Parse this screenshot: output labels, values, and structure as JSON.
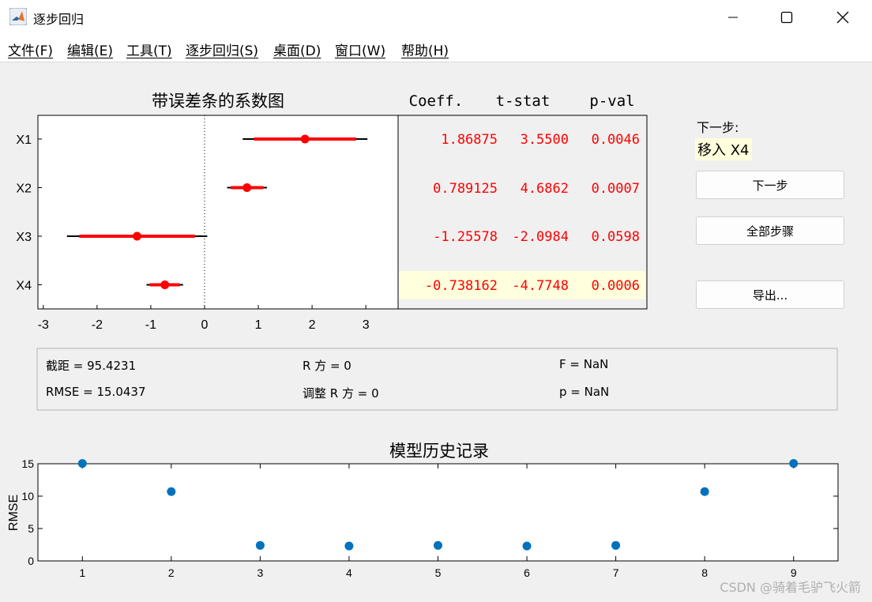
{
  "window": {
    "title": "逐步回归",
    "minimize_label": "—",
    "maximize_label": "☐",
    "close_label": "✕"
  },
  "menu": [
    "文件(F)",
    "编辑(E)",
    "工具(T)",
    "逐步回归(S)",
    "桌面(D)",
    "窗口(W)",
    "帮助(H)"
  ],
  "coef_plot": {
    "title": "带误差条的系数图",
    "terms": [
      "X1",
      "X2",
      "X3",
      "X4"
    ],
    "xticks": [
      "-3",
      "-2",
      "-1",
      "0",
      "1",
      "2",
      "3"
    ]
  },
  "coef_table": {
    "headers": [
      "Coeff.",
      "t-stat",
      "p-val"
    ],
    "rows": [
      {
        "coeff": "1.86875",
        "tstat": "3.5500",
        "pval": "0.0046",
        "highlight": false
      },
      {
        "coeff": "0.789125",
        "tstat": "4.6862",
        "pval": "0.0007",
        "highlight": false
      },
      {
        "coeff": "-1.25578",
        "tstat": "-2.0984",
        "pval": "0.0598",
        "highlight": false
      },
      {
        "coeff": "-0.738162",
        "tstat": "-4.7748",
        "pval": "0.0006",
        "highlight": true
      }
    ],
    "value_color": "#ff0000",
    "highlight_color": "#ffffdd"
  },
  "side_panel": {
    "next_step_label": "下一步:",
    "next_step_value": "移入 X4",
    "next_button": "下一步",
    "all_steps_button": "全部步骤",
    "export_button": "导出..."
  },
  "stats": {
    "intercept": "截距 = 95.4231",
    "r2": "R 方 = 0",
    "f": "F = NaN",
    "rmse": "RMSE = 15.0437",
    "adj_r2": "调整 R 方 = 0",
    "p": "p = NaN"
  },
  "chart_data": [
    {
      "type": "scatter",
      "title": "带误差条的系数图",
      "categories": [
        "X1",
        "X2",
        "X3",
        "X4"
      ],
      "coefficients": [
        1.86875,
        0.789125,
        -1.25578,
        -0.738162
      ],
      "ci_inner": [
        [
          0.92,
          2.82
        ],
        [
          0.49,
          1.09
        ],
        [
          -2.33,
          -0.18
        ],
        [
          -1.02,
          -0.46
        ]
      ],
      "ci_outer": [
        [
          0.71,
          3.03
        ],
        [
          0.42,
          1.16
        ],
        [
          -2.56,
          0.05
        ],
        [
          -1.08,
          -0.4
        ]
      ],
      "xlim": [
        -3.1,
        3.6
      ],
      "color": "#ff0000",
      "zero_line": true
    },
    {
      "type": "scatter",
      "title": "模型历史记录",
      "xlabel": "",
      "ylabel": "RMSE",
      "x": [
        1,
        2,
        3,
        4,
        5,
        6,
        7,
        8,
        9
      ],
      "y": [
        15.04,
        10.7,
        2.4,
        2.3,
        2.4,
        2.3,
        2.4,
        10.7,
        15.04
      ],
      "xlim": [
        0.5,
        9.5
      ],
      "ylim": [
        0,
        15
      ],
      "yticks": [
        0,
        5,
        10,
        15
      ],
      "color": "#0072bd"
    }
  ],
  "watermark": "CSDN @骑着毛驴飞火箭"
}
